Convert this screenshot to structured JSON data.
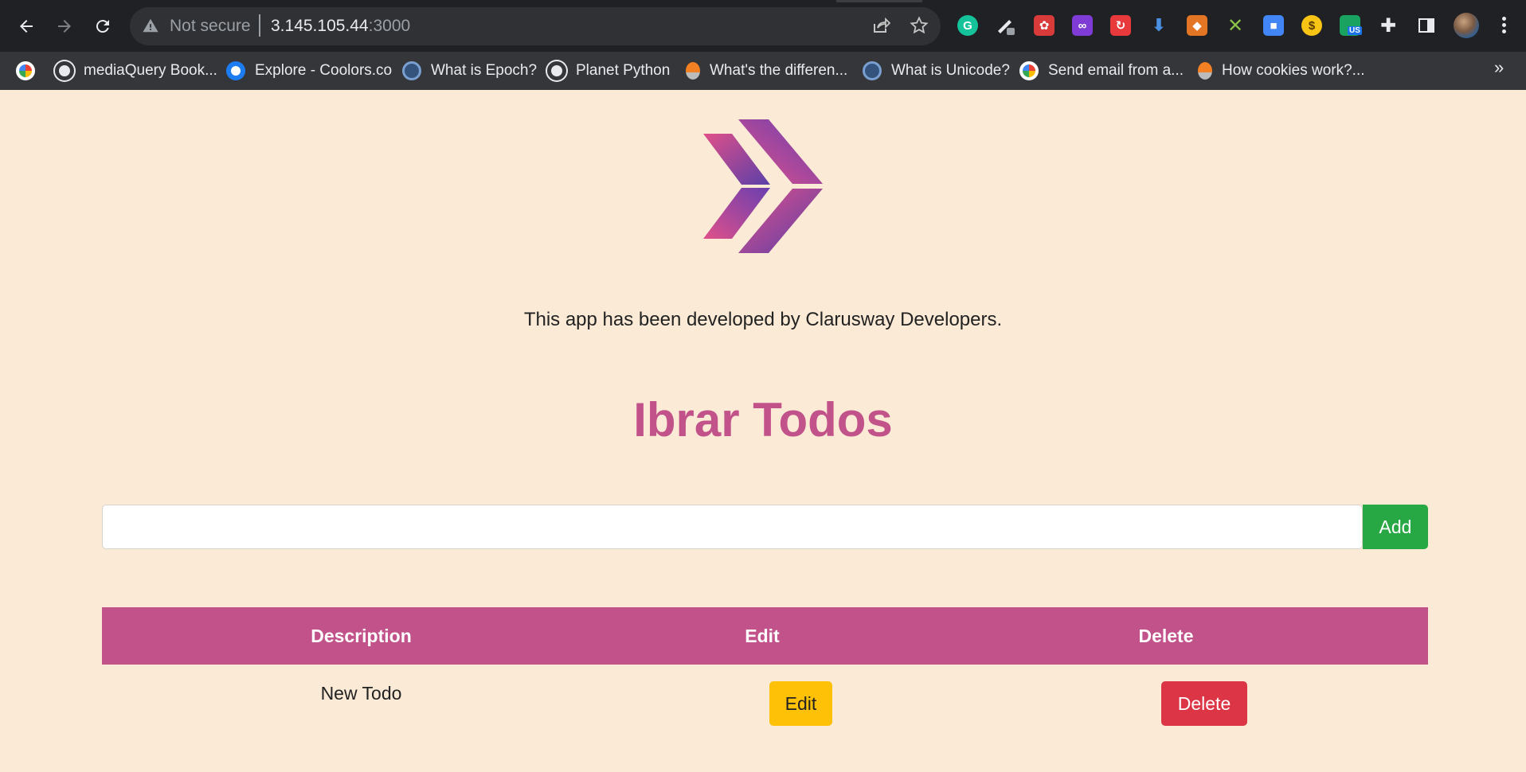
{
  "browser": {
    "not_secure_label": "Not secure",
    "url_host": "3.145.105.44",
    "url_port": ":3000",
    "extension_badge": "US",
    "bookmarks": [
      {
        "label": "",
        "favicon": "google-icon"
      },
      {
        "label": "mediaQuery Book...",
        "favicon": "globe-icon"
      },
      {
        "label": "Explore - Coolors.co",
        "favicon": "coolors-icon"
      },
      {
        "label": "What is Epoch?",
        "favicon": "epoch-icon"
      },
      {
        "label": "Planet Python",
        "favicon": "globe-icon"
      },
      {
        "label": "What's the differen...",
        "favicon": "stackoverflow-icon"
      },
      {
        "label": "What is Unicode?",
        "favicon": "epoch-icon"
      },
      {
        "label": "Send email from a...",
        "favicon": "google-icon"
      },
      {
        "label": "How cookies work?...",
        "favicon": "stackoverflow-icon"
      }
    ],
    "more_bookmarks_glyph": "»"
  },
  "app": {
    "credit": "This app has been developed by Clarusway Developers.",
    "title": "Ibrar Todos",
    "input_value": "",
    "add_label": "Add",
    "columns": [
      "Description",
      "Edit",
      "Delete"
    ],
    "todos": [
      {
        "description": "New Todo",
        "edit_label": "Edit",
        "delete_label": "Delete"
      }
    ]
  },
  "colors": {
    "page_bg": "#faead6",
    "accent": "#c2528a",
    "add": "#28a745",
    "edit": "#ffc107",
    "delete": "#dc3545"
  }
}
